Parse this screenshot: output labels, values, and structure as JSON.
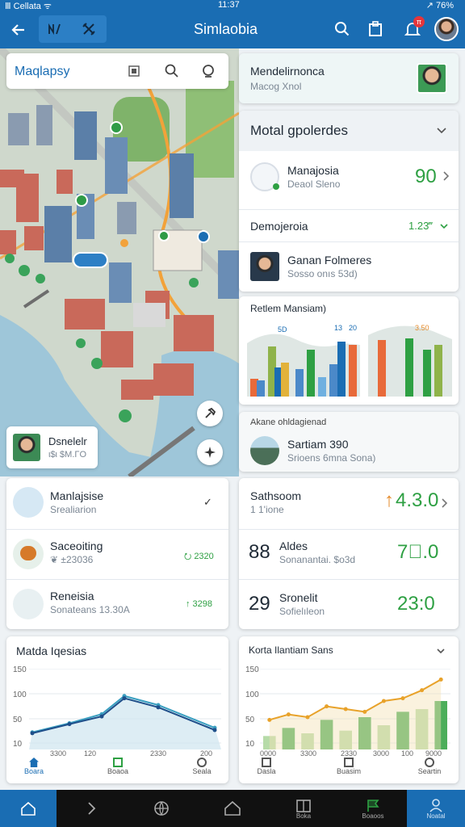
{
  "status_bar": {
    "left": "Ⅲ Cellata ᯤ",
    "time": "11:37",
    "right": "↗ 76%"
  },
  "header": {
    "title": "Simlaobia",
    "badge": "π",
    "bg": "#1a6db3"
  },
  "map_search": {
    "label": "Maqlapsy"
  },
  "map_popup": {
    "name": "Dsnelelr",
    "sub": "ι$ι $Μ.ΓΟ"
  },
  "right_top": {
    "name": "Mendelirnonca",
    "sub": "Macog Xnol"
  },
  "panel1": {
    "title": "Motal gpolerdes",
    "row1": {
      "name": "Manajosia",
      "sub": "Deaol Sleno",
      "value": "90"
    },
    "row2": {
      "name": "Demojeroia",
      "value": "1.23‴"
    },
    "row3": {
      "name": "Ganan Folmeres",
      "sub": "Sosso onıs 53d)"
    }
  },
  "bars_card": {
    "title": "Retlem Mansiam)",
    "labels": [
      "5D",
      "13",
      "20",
      "3.50"
    ]
  },
  "about_card": {
    "title": "Akane ohldagienad",
    "name": "Sartiam 390",
    "sub": "Srioens 6mna Sona)"
  },
  "left_list": [
    {
      "name": "Manlajsise",
      "sub": "Srealiarion",
      "value": "✓"
    },
    {
      "name": "Saceoiting",
      "sub": "❦ ±23036",
      "value": "⭮ 2320"
    },
    {
      "name": "Reneisia",
      "sub": "Sonateans 13.30A",
      "value": "↑ 3298"
    }
  ],
  "stats": [
    {
      "prefix": "",
      "name": "Sathsoom",
      "sub": "1 1'ione",
      "value": "4.3.0",
      "arrow": "↑"
    },
    {
      "prefix": "88",
      "name": "Aldes",
      "sub": "Sonanantai. $o3d",
      "value": "7⃝.0",
      "arrow": ""
    },
    {
      "prefix": "29",
      "name": "Sronelit",
      "sub": "Sofielıleon",
      "value": "23:0",
      "arrow": ""
    }
  ],
  "line_card": {
    "title": "Matda Iqesias",
    "y_ticks": [
      "150",
      "100",
      "50",
      "10"
    ],
    "footer": [
      {
        "icon": "home-icon",
        "label": "Boara"
      },
      {
        "icon": "flag-icon",
        "label": "Boaoa"
      },
      {
        "icon": "clock-icon",
        "label": "Seala"
      }
    ],
    "x_ticks": [
      "3300",
      "120",
      "2330",
      "200"
    ],
    "chart_data": {
      "type": "line",
      "series": [
        {
          "values": [
            20,
            40,
            60,
            100,
            80,
            30
          ]
        },
        {
          "values": [
            18,
            38,
            55,
            95,
            75,
            25
          ]
        }
      ]
    }
  },
  "combo_card": {
    "title": "Korta Ilantiam Sans",
    "y_ticks": [
      "150",
      "100",
      "50",
      "10"
    ],
    "x_ticks": [
      "0000",
      "3300",
      "2330",
      "3000",
      "100",
      "9000"
    ],
    "footer": [
      {
        "icon": "calendar-icon",
        "label": "Dasla"
      },
      {
        "icon": "image-icon",
        "label": "Buasim"
      },
      {
        "icon": "settings-icon",
        "label": "Seartin"
      }
    ],
    "chart_data": {
      "type": "bar",
      "bars": [
        25,
        40,
        30,
        55,
        35,
        60,
        45,
        70,
        75,
        90
      ],
      "line": [
        55,
        65,
        60,
        80,
        75,
        70,
        90,
        95,
        110,
        130
      ]
    }
  },
  "bottom_nav": [
    {
      "icon": "home-icon",
      "label": ""
    },
    {
      "icon": "chevron-right-icon",
      "label": ""
    },
    {
      "icon": "globe-icon",
      "label": ""
    },
    {
      "icon": "house-icon",
      "label": ""
    },
    {
      "icon": "book-icon",
      "label": "Boka"
    },
    {
      "icon": "flag-icon",
      "label": "Boaoos"
    },
    {
      "icon": "user-icon",
      "label": "Noatal"
    }
  ]
}
